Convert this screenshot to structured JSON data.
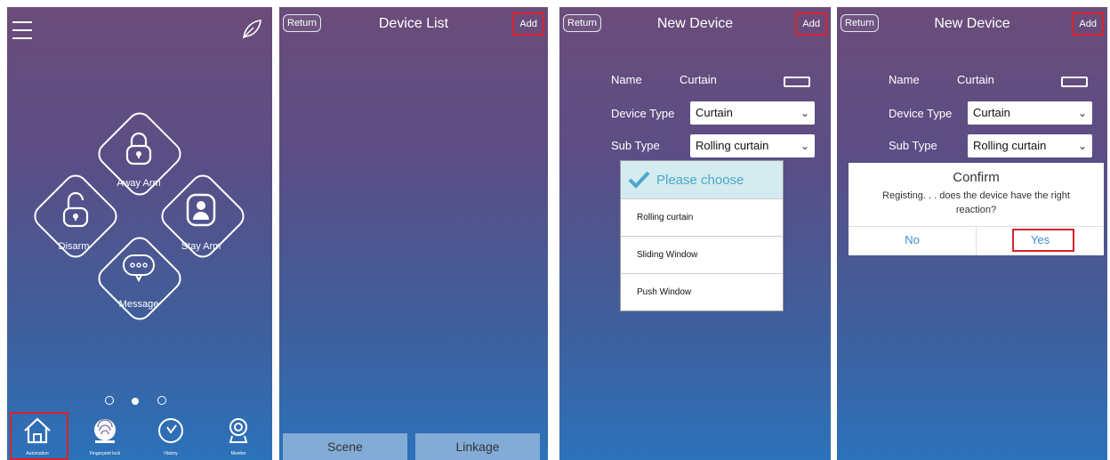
{
  "screen1": {
    "arm_items": [
      {
        "label": "Away Arm"
      },
      {
        "label": "Disarm"
      },
      {
        "label": "Stay Arm"
      },
      {
        "label": "Message"
      }
    ],
    "nav": [
      {
        "label": "Automation"
      },
      {
        "label": "Fingerprint lock"
      },
      {
        "label": "History"
      },
      {
        "label": "Monitor"
      }
    ]
  },
  "screen2": {
    "return_label": "Return",
    "title": "Device  List",
    "add_label": "Add",
    "tabs": [
      "Scene",
      "Linkage"
    ]
  },
  "screen3": {
    "return_label": "Return",
    "title": "New Device",
    "add_label": "Add",
    "name_label": "Name",
    "name_value": "Curtain",
    "device_type_label": "Device Type",
    "device_type_value": "Curtain",
    "sub_type_label": "Sub Type",
    "sub_type_value": "Rolling curtain",
    "dropdown_header": "Please choose",
    "dropdown_options": [
      "Rolling curtain",
      "Sliding Window",
      "Push Window"
    ]
  },
  "screen4": {
    "return_label": "Return",
    "title": "New Device",
    "add_label": "Add",
    "name_label": "Name",
    "name_value": "Curtain",
    "device_type_label": "Device Type",
    "device_type_value": "Curtain",
    "sub_type_label": "Sub Type",
    "sub_type_value": "Rolling curtain",
    "dialog": {
      "title": "Confirm",
      "message": "Registing. . . does the device have the right reaction?",
      "no_label": "No",
      "yes_label": "Yes"
    }
  },
  "colors": {
    "highlight": "#d9232b",
    "accent": "#3a8fd6",
    "check": "#4aa7cc"
  }
}
